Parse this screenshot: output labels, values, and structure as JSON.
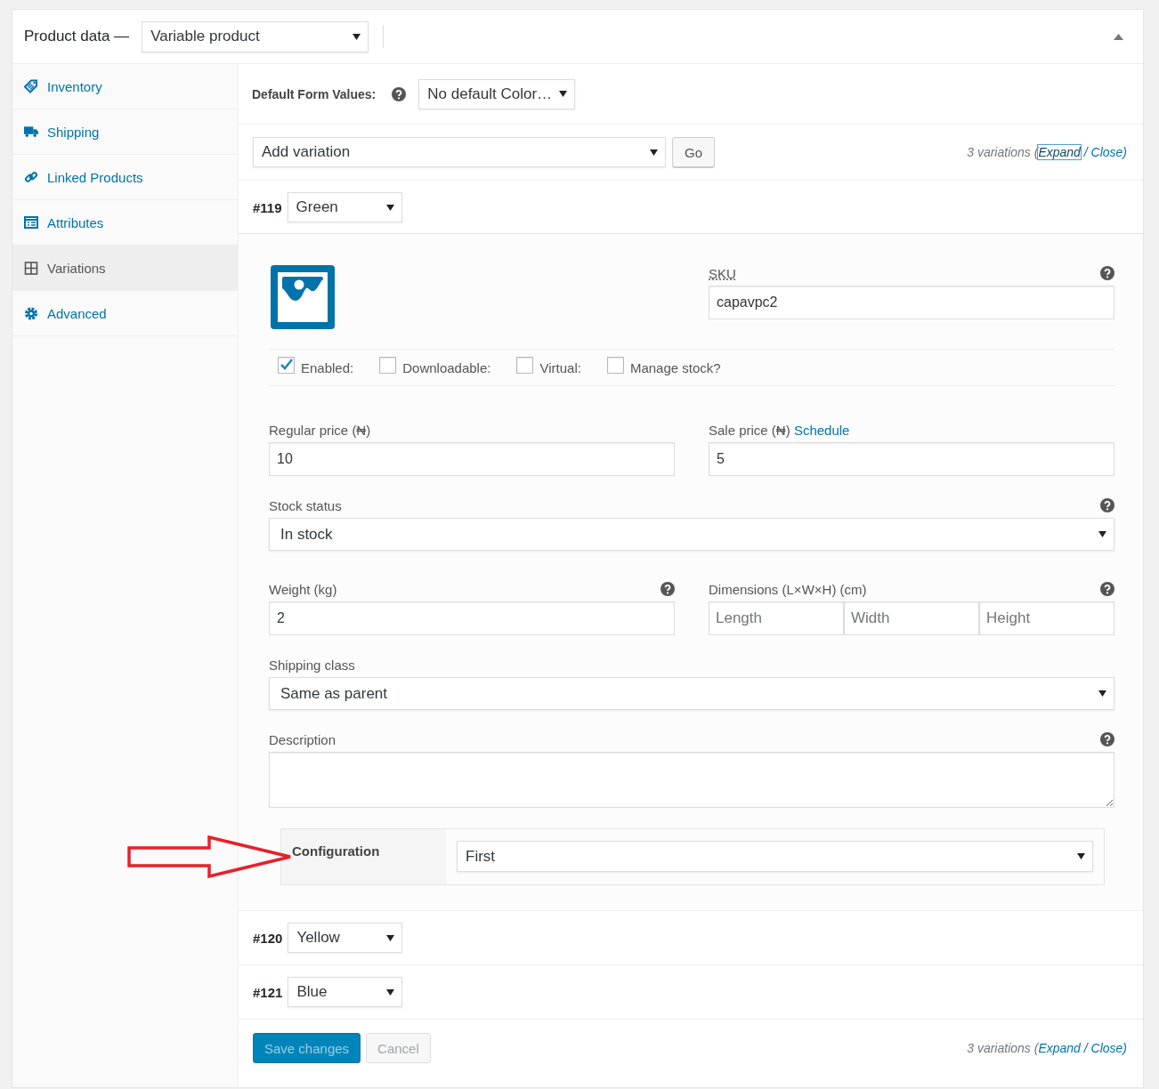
{
  "header": {
    "title": "Product data —",
    "product_type": "Variable product"
  },
  "sidebar": {
    "items": [
      {
        "label": "Inventory",
        "kind": "tag",
        "selected": false
      },
      {
        "label": "Shipping",
        "kind": "truck",
        "selected": false
      },
      {
        "label": "Linked Products",
        "kind": "link",
        "selected": false
      },
      {
        "label": "Attributes",
        "kind": "list",
        "selected": false
      },
      {
        "label": "Variations",
        "kind": "grid",
        "selected": true
      },
      {
        "label": "Advanced",
        "kind": "gear",
        "selected": false
      }
    ]
  },
  "default_form": {
    "label": "Default Form Values:",
    "help": true,
    "value": "No default Color…"
  },
  "toolbar": {
    "action": "Add variation",
    "go": "Go",
    "summary": {
      "count": "3 variations (",
      "expand": "Expand",
      "expand_focused": true,
      "close": "/ Close)"
    }
  },
  "variations": [
    {
      "id": "#119",
      "attribute": "Green",
      "expanded": true,
      "details": {
        "sku": {
          "label": "SKU",
          "value": "capavpc2",
          "help": true
        },
        "options": [
          {
            "label": "Enabled:",
            "checked": true
          },
          {
            "label": "Downloadable:",
            "checked": false
          },
          {
            "label": "Virtual:",
            "checked": false
          },
          {
            "label": "Manage stock?",
            "checked": false
          }
        ],
        "regular_price": {
          "label": "Regular price (₦)",
          "value": "10"
        },
        "sale_price": {
          "label": "Sale price (₦)",
          "link": "Schedule",
          "value": "5"
        },
        "stock_status": {
          "label": "Stock status",
          "value": "In stock",
          "help": true
        },
        "weight": {
          "label": "Weight (kg)",
          "value": "2",
          "help": true
        },
        "dimensions": {
          "label": "Dimensions (L×W×H) (cm)",
          "placeholders": [
            "Length",
            "Width",
            "Height"
          ],
          "help": true
        },
        "shipping_class": {
          "label": "Shipping class",
          "value": "Same as parent"
        },
        "description": {
          "label": "Description",
          "help": true
        },
        "configuration": {
          "label": "Configuration",
          "value": "First"
        }
      }
    },
    {
      "id": "#120",
      "attribute": "Yellow",
      "expanded": false
    },
    {
      "id": "#121",
      "attribute": "Blue",
      "expanded": false
    }
  ],
  "footer": {
    "buttons": [
      {
        "label": "Save changes",
        "kind": "primary",
        "disabled": true
      },
      {
        "label": "Cancel",
        "kind": "secondary",
        "disabled": true
      }
    ],
    "summary": {
      "count": "3 variations (",
      "expand": "Expand",
      "expand_focused": false,
      "close": "/ Close)"
    }
  }
}
